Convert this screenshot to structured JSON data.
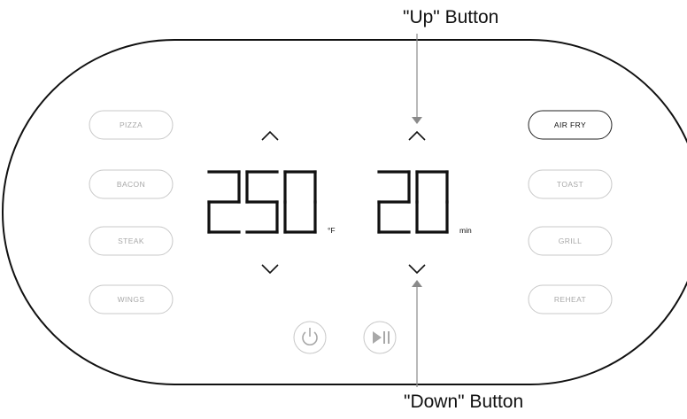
{
  "callouts": {
    "up": "\"Up\" Button",
    "down": "\"Down\" Button"
  },
  "display": {
    "temperature": "250",
    "temperature_unit": "°F",
    "time": "20",
    "time_unit": "min"
  },
  "presets_left": [
    "PIZZA",
    "BACON",
    "STEAK",
    "WINGS"
  ],
  "presets_right": [
    "AIR FRY",
    "TOAST",
    "GRILL",
    "REHEAT"
  ],
  "selected_preset": "AIR FRY",
  "controls": {
    "temp_up_icon": "chevron-up-icon",
    "temp_down_icon": "chevron-down-icon",
    "time_up_icon": "chevron-up-icon",
    "time_down_icon": "chevron-down-icon",
    "power_icon": "power-icon",
    "start_pause_icon": "play-pause-icon"
  },
  "colors": {
    "outline": "#111111",
    "pill_border": "#c8c8c8",
    "pill_text": "#a8a8a8",
    "arrow": "#8a8a8a"
  }
}
